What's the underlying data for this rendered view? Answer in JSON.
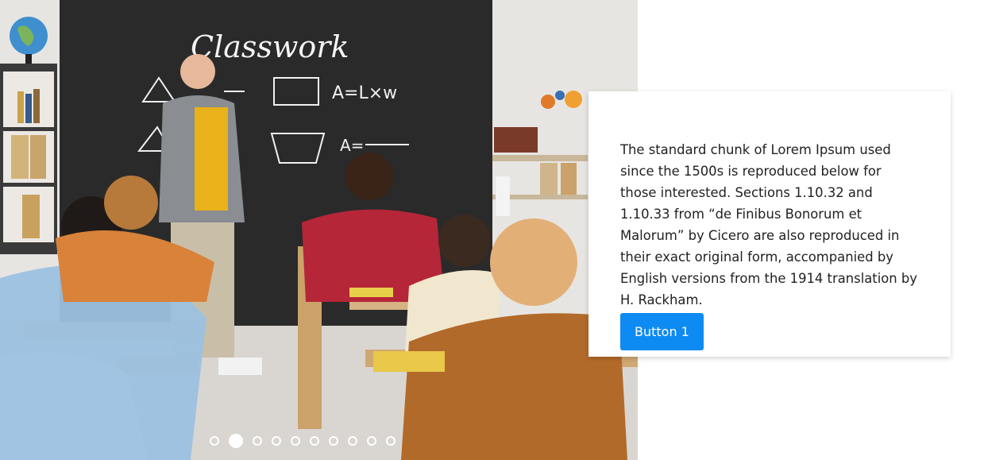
{
  "slide": {
    "image_label": "classroom-photo",
    "chalkboard_title": "Classwork",
    "card_text": "The standard chunk of Lorem Ipsum used since the 1500s is reproduced below for those interested. Sections 1.10.32 and 1.10.33 from “de Finibus Bonorum et Malorum” by Cicero are also reproduced in their exact original form, accompanied by English versions from the 1914 translation by H. Rackham.",
    "button_label": "Button 1"
  },
  "pagination": {
    "count": 10,
    "active_index": 1
  },
  "colors": {
    "accent": "#0d8bf2",
    "chalkboard": "#2a2a2a"
  }
}
